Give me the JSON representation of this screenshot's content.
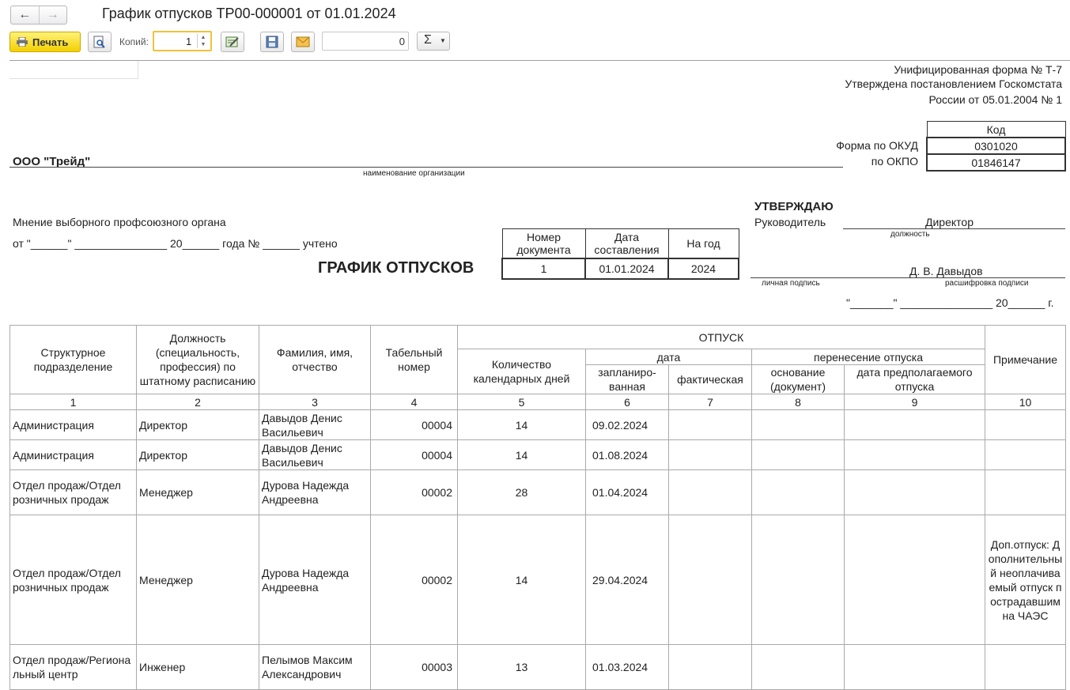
{
  "window": {
    "title": "График отпусков ТР00-000001 от 01.01.2024",
    "back_icon": "←",
    "forward_icon": "→"
  },
  "toolbar": {
    "print_label": "Печать",
    "copies_label": "Копий:",
    "copies_value": "1",
    "number_value": "0",
    "sigma": "Σ"
  },
  "doc": {
    "unified_form": [
      "Унифицированная форма № Т-7",
      "Утверждена постановлением Госкомстата",
      "России от 05.01.2004 № 1"
    ],
    "code_header": "Код",
    "okud_label": "Форма по ОКУД",
    "okud_value": "0301020",
    "okpo_label": "по ОКПО",
    "okpo_value": "01846147",
    "org_name": "ООО \"Трейд\"",
    "org_caption": "наименование организации",
    "approve_title": "УТВЕРЖДАЮ",
    "head_label": "Руководитель",
    "head_position": "Директор",
    "position_caption": "должность",
    "head_name": "Д. В. Давыдов",
    "signature_caption": "личная подпись",
    "decode_caption": "расшифровка подписи",
    "approve_date": "\"_______\" _______________ 20______ г.",
    "union_opinion": "Мнение выборного профсоюзного органа",
    "union_line": "от \"______\" _______________ 20______ года № ______ учтено",
    "schedule_title": "ГРАФИК ОТПУСКОВ",
    "docnum_header": "Номер документа",
    "docdate_header": "Дата составления",
    "year_header": "На год",
    "docnum_value": "1",
    "docdate_value": "01.01.2024",
    "year_value": "2024"
  },
  "table": {
    "h_dept": "Структурное подразделение",
    "h_position": "Должность (специальность, профессия) по штатному расписанию",
    "h_name": "Фамилия, имя, отчество",
    "h_tabnum": "Табельный номер",
    "h_vacation": "ОТПУСК",
    "h_days": "Количество календарных дней",
    "h_date": "дата",
    "h_transfer": "перенесение отпуска",
    "h_planned": "запланиро-ванная",
    "h_actual": "фактическая",
    "h_basis": "основание (документ)",
    "h_expected": "дата предполагаемого отпуска",
    "h_note": "Примечание",
    "col_numbers": [
      "1",
      "2",
      "3",
      "4",
      "5",
      "6",
      "7",
      "8",
      "9",
      "10"
    ],
    "rows": [
      {
        "dept": "Администрация",
        "position": "Директор",
        "name": "Давыдов Денис Васильевич",
        "tabnum": "00004",
        "days": "14",
        "planned": "09.02.2024",
        "note": ""
      },
      {
        "dept": "Администрация",
        "position": "Директор",
        "name": "Давыдов Денис Васильевич",
        "tabnum": "00004",
        "days": "14",
        "planned": "01.08.2024",
        "note": ""
      },
      {
        "dept": "Отдел продаж/Отдел розничных продаж",
        "position": "Менеджер",
        "name": "Дурова Надежда Андреевна",
        "tabnum": "00002",
        "days": "28",
        "planned": "01.04.2024",
        "note": ""
      },
      {
        "dept": "Отдел продаж/Отдел розничных продаж",
        "position": "Менеджер",
        "name": "Дурова Надежда Андреевна",
        "tabnum": "00002",
        "days": "14",
        "planned": "29.04.2024",
        "note": "Доп.отпуск: Дополнительный неоплачиваемый отпуск пострадавшим на ЧАЭС"
      },
      {
        "dept": "Отдел продаж/Региональный центр",
        "position": "Инженер",
        "name": "Пелымов Максим Александрович",
        "tabnum": "00003",
        "days": "13",
        "planned": "01.03.2024",
        "note": ""
      }
    ]
  }
}
